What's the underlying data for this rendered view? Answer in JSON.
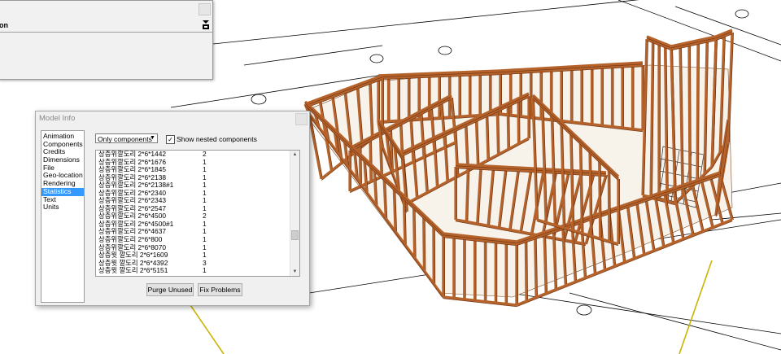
{
  "tray": {
    "title": "on"
  },
  "dialog": {
    "title": "Model Info",
    "nav_items": [
      "Animation",
      "Components",
      "Credits",
      "Dimensions",
      "File",
      "Geo-location",
      "Rendering",
      "Statistics",
      "Text",
      "Units"
    ],
    "selected_nav": "Statistics",
    "filter_value": "Only components",
    "nested_label": "Show nested components",
    "nested_checked": true,
    "stats_rows": [
      {
        "name": "상층위깔도리 2*6*1442",
        "count": "2"
      },
      {
        "name": "상층위깔도리 2*6*1676",
        "count": "1"
      },
      {
        "name": "상층위깔도리 2*6*1845",
        "count": "1"
      },
      {
        "name": "상층위깔도리 2*6*2138",
        "count": "1"
      },
      {
        "name": "상층위깔도리 2*6*2138#1",
        "count": "1"
      },
      {
        "name": "상층위깔도리 2*6*2340",
        "count": "1"
      },
      {
        "name": "상층위깔도리 2*6*2343",
        "count": "1"
      },
      {
        "name": "상층위깔도리 2*6*2547",
        "count": "1"
      },
      {
        "name": "상층위깔도리 2*6*4500",
        "count": "2"
      },
      {
        "name": "상층위깔도리 2*6*4500#1",
        "count": "1"
      },
      {
        "name": "상층위깔도리 2*6*4637",
        "count": "1"
      },
      {
        "name": "상층위깔도리 2*6*800",
        "count": "1"
      },
      {
        "name": "상층위깔도리 2*6*8070",
        "count": "1"
      },
      {
        "name": "상층윗 깔도리 2*6*1609",
        "count": "1"
      },
      {
        "name": "상층윗 깔도리 2*6*4392",
        "count": "3"
      },
      {
        "name": "상층윗 깔도리 2*6*5151",
        "count": "1"
      }
    ],
    "purge_label": "Purge Unused",
    "fix_label": "Fix Problems"
  },
  "colors": {
    "selection": "#3399ff",
    "timber": "#b5622b",
    "timber_dark": "#6e3413"
  }
}
